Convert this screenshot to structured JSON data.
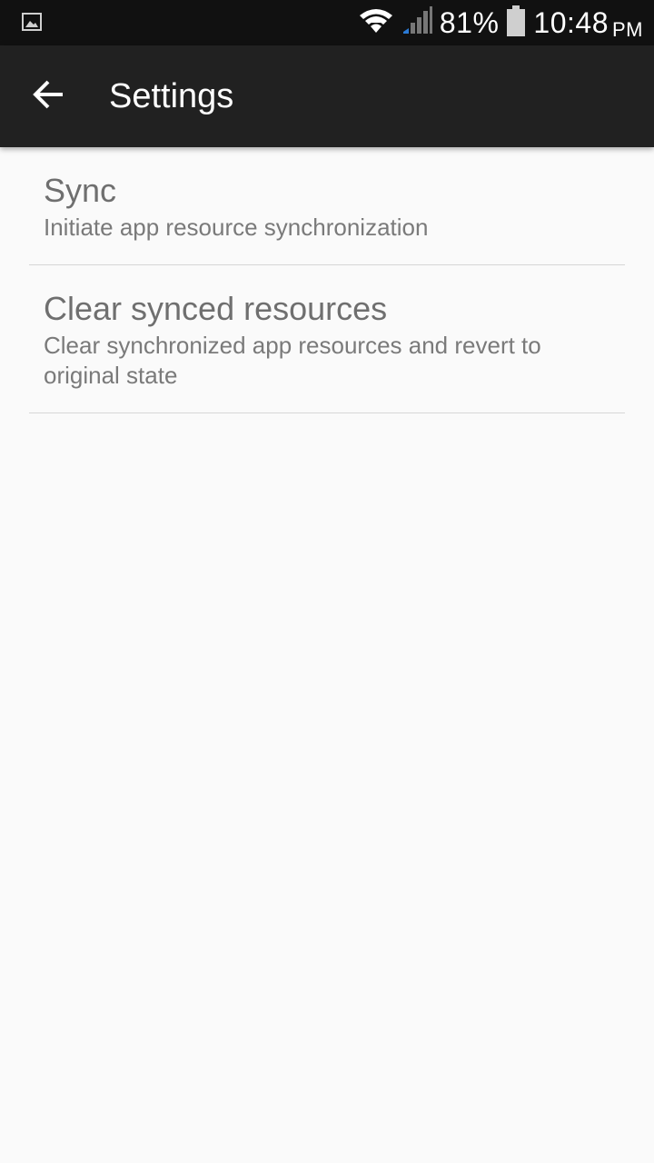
{
  "status_bar": {
    "notification_icon": "image-icon",
    "wifi_icon": "wifi-icon",
    "signal_icon": "cell-signal-icon",
    "battery_percent": "81%",
    "battery_icon": "battery-icon",
    "time": "10:48",
    "ampm": "PM"
  },
  "action_bar": {
    "back_icon": "arrow-left-icon",
    "title": "Settings"
  },
  "preferences": [
    {
      "title": "Sync",
      "summary": "Initiate app resource synchronization"
    },
    {
      "title": "Clear synced resources",
      "summary": "Clear synchronized app resources and revert to original state"
    }
  ],
  "colors": {
    "status_bar_bg": "#111111",
    "action_bar_bg": "#212121",
    "content_bg": "#fafafa",
    "text_secondary": "#6f6f6f",
    "divider": "#d6d6d6"
  }
}
